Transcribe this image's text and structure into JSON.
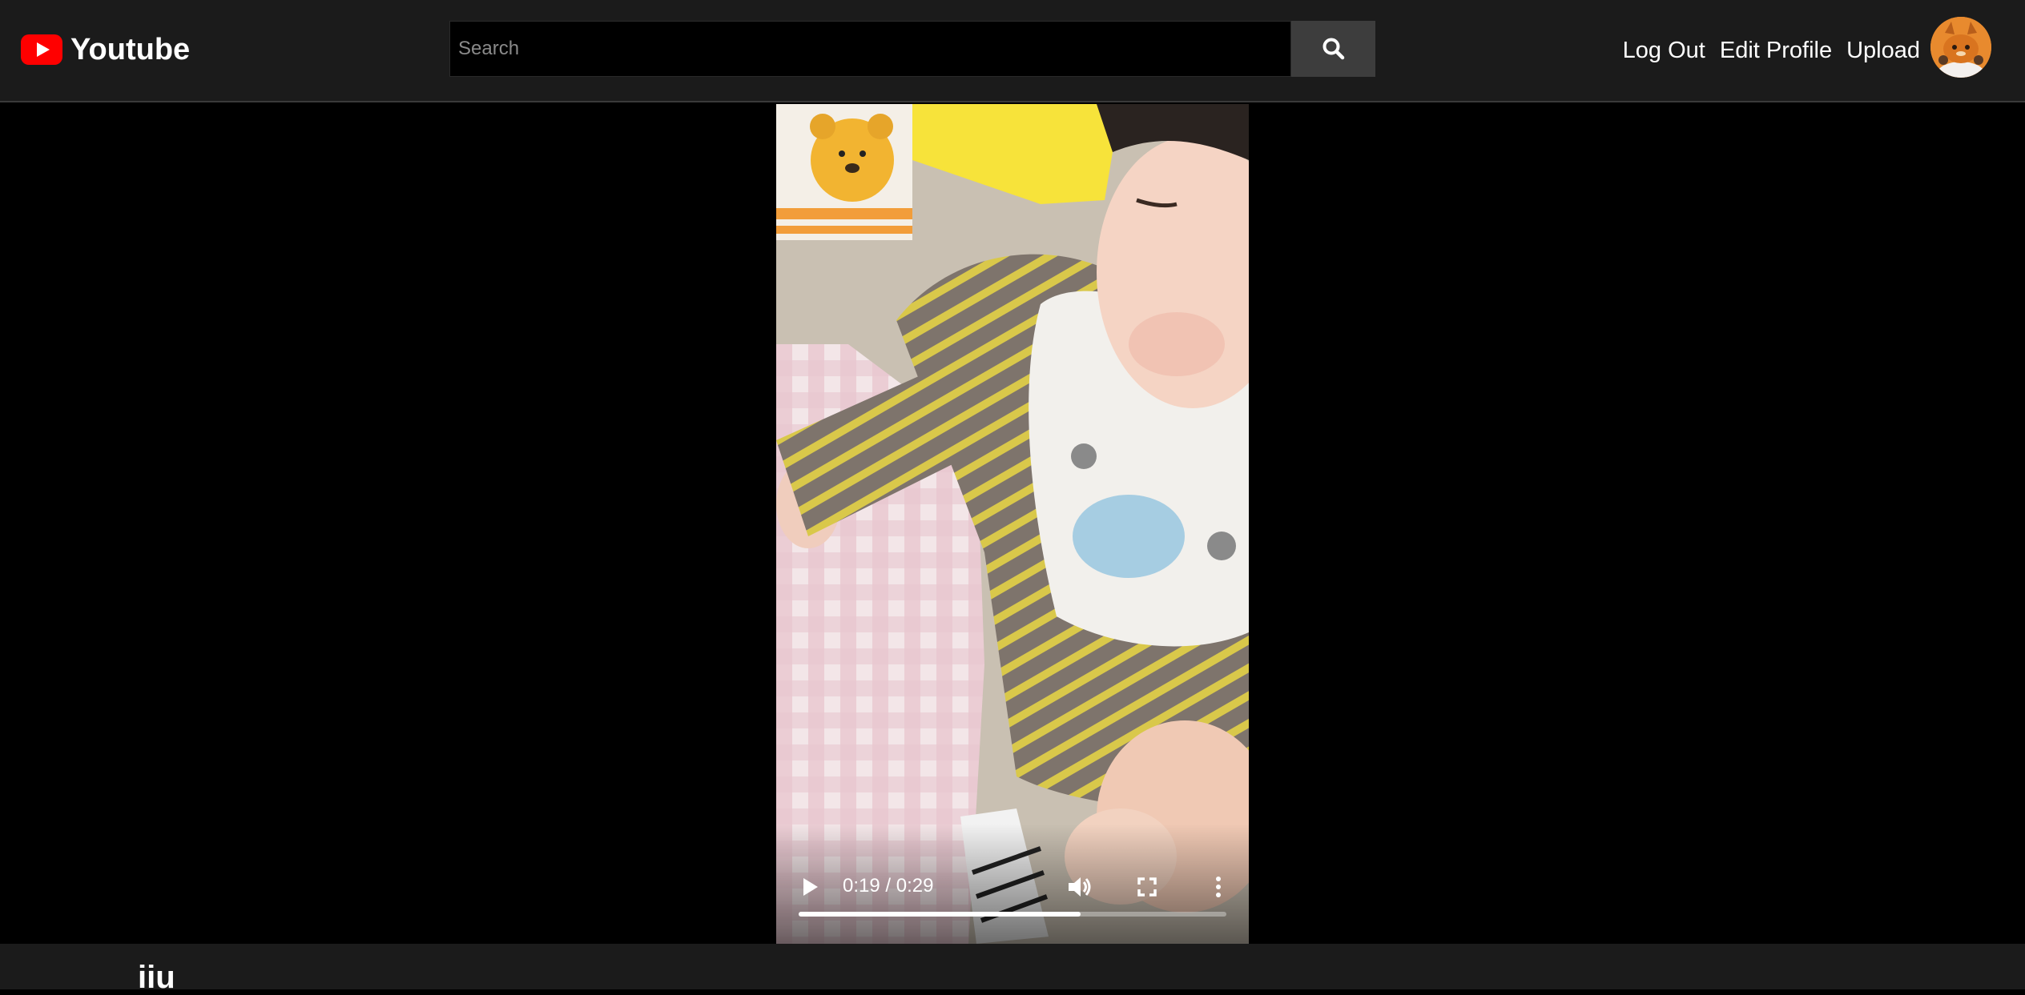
{
  "brand": {
    "name": "Youtube"
  },
  "search": {
    "placeholder": "Search"
  },
  "nav": {
    "logout": "Log Out",
    "edit_profile": "Edit Profile",
    "upload": "Upload"
  },
  "video": {
    "time_display": "0:19 / 0:29",
    "progress_fraction": 0.66,
    "title": "iiu"
  },
  "colors": {
    "navbar_bg": "#1b1b1b",
    "brand_red": "#ff0000",
    "search_button_bg": "#3d3d3d",
    "page_bg": "#000000"
  },
  "icons": {
    "search": "magnifier-icon",
    "play": "play-icon",
    "volume": "volume-icon",
    "fullscreen": "fullscreen-icon",
    "more": "more-vertical-icon"
  }
}
